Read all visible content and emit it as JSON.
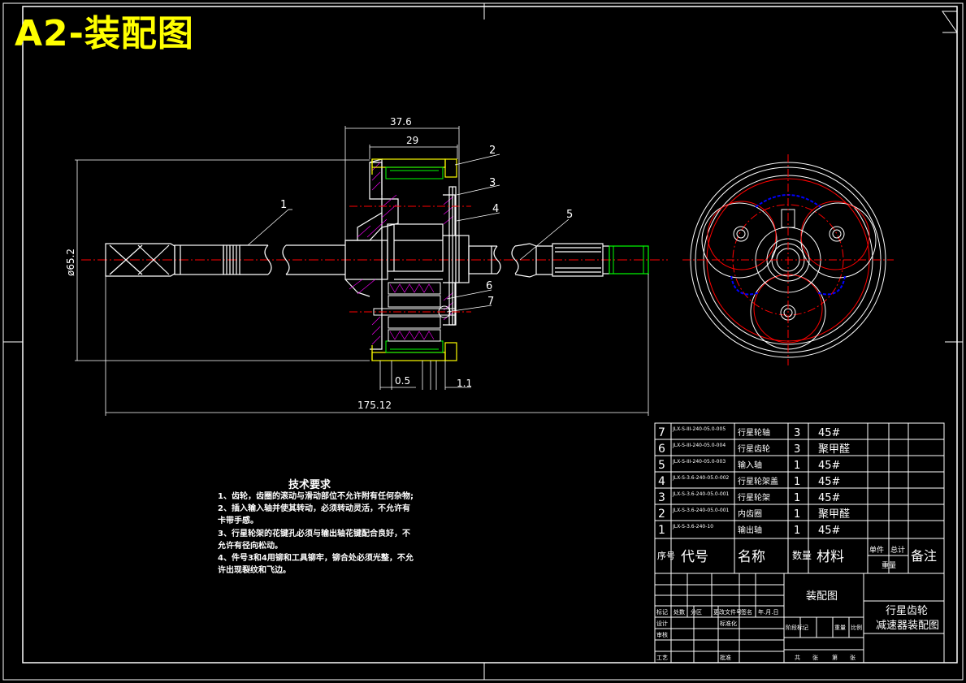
{
  "sheet_title": "A2-装配图",
  "dimensions": {
    "d1": "37.6",
    "d2": "29",
    "d3": "ø65.2",
    "d4": "0.5",
    "d5": "1.1",
    "d6": "175.12"
  },
  "balloons": [
    "1",
    "2",
    "3",
    "4",
    "5",
    "6",
    "7"
  ],
  "tech_requirements": {
    "title": "技术要求",
    "items": [
      "1、齿轮，齿圈的滚动与滑动部位不允许附有任何杂物;",
      "2、插入输入轴并使其转动，必须转动灵活，不允许有",
      "    卡带手感。",
      "3、行星轮架的花键孔必须与输出轴花键配合良好，不",
      "    允许有径向松动。",
      "4、件号3和4用铆和工具铆牢，铆合处必须光整，不允",
      "    许出现裂纹和飞边。"
    ]
  },
  "bom": {
    "rows": [
      {
        "no": "7",
        "code": "JLX-S-III-240-05.0-005",
        "name": "行星轮轴",
        "qty": "3",
        "material": "45#"
      },
      {
        "no": "6",
        "code": "JLX-S-III-240-05.0-004",
        "name": "行星齿轮",
        "qty": "3",
        "material": "聚甲醛"
      },
      {
        "no": "5",
        "code": "JLX-S-III-240-05.0-003",
        "name": "输入轴",
        "qty": "1",
        "material": "45#"
      },
      {
        "no": "4",
        "code": "JLX-S-3.6-240-05.0-002",
        "name": "行星轮架盖",
        "qty": "1",
        "material": "45#"
      },
      {
        "no": "3",
        "code": "JLX-S-3.6-240-05.0-001",
        "name": "行星轮架",
        "qty": "1",
        "material": "45#"
      },
      {
        "no": "2",
        "code": "JLX-S-3.6-240-05.0-001",
        "name": "内齿圈",
        "qty": "1",
        "material": "聚甲醛"
      },
      {
        "no": "1",
        "code": "JLX-S-3.6-240-10",
        "name": "输出轴",
        "qty": "1",
        "material": "45#"
      }
    ],
    "header": {
      "no": "序号",
      "code": "代号",
      "name": "名称",
      "qty": "数量",
      "material": "材料",
      "unit_weight": "单件",
      "total_weight": "总计",
      "weight": "重量",
      "remark": "备注"
    }
  },
  "title_block": {
    "drawing_type": "装配图",
    "drawing_name_line1": "行星齿轮",
    "drawing_name_line2": "减速器装配图",
    "rev_cols": [
      "标记",
      "处数",
      "分区",
      "更改文件号",
      "签名",
      "年.月.日"
    ],
    "roles": [
      "设计",
      "审核",
      "工艺"
    ],
    "role_cols": [
      "标准化",
      "批准"
    ],
    "stage_cols": [
      "阶段标记",
      "重量",
      "比例"
    ],
    "sheet_cols": [
      "共",
      "张",
      "第",
      "张"
    ]
  },
  "colors": {
    "background": "#000000",
    "lines": "#ffffff",
    "title": "#ffff00",
    "centerline": "#ff0000",
    "hidden": "#0000ff",
    "part_yellow": "#ffff00",
    "part_green": "#00ff00",
    "hatch": "#ff00ff"
  }
}
